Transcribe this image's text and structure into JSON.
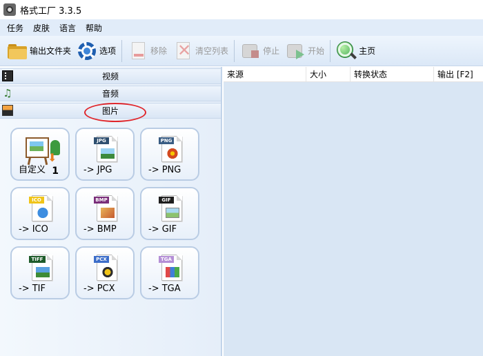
{
  "window": {
    "title": "格式工厂 3.3.5"
  },
  "menu": {
    "items": [
      "任务",
      "皮肤",
      "语言",
      "帮助"
    ]
  },
  "toolbar": {
    "output_folder": "输出文件夹",
    "options": "选项",
    "remove": "移除",
    "clear_list": "清空列表",
    "stop": "停止",
    "start": "开始",
    "home": "主页"
  },
  "categories": {
    "video": "视频",
    "audio": "音频",
    "image": "图片"
  },
  "image_tools": [
    {
      "label": "自定义",
      "badge": "1",
      "icon": "custom-icon"
    },
    {
      "label": "-> JPG",
      "tag": "JPG",
      "tag_color": "#2f4f6f",
      "icon": "jpg-file-icon"
    },
    {
      "label": "-> PNG",
      "tag": "PNG",
      "tag_color": "#3a5d83",
      "icon": "png-file-icon"
    },
    {
      "label": "-> ICO",
      "tag": "ICO",
      "tag_color": "#f0c419",
      "icon": "ico-file-icon"
    },
    {
      "label": "-> BMP",
      "tag": "BMP",
      "tag_color": "#7a2e7a",
      "icon": "bmp-file-icon"
    },
    {
      "label": "-> GIF",
      "tag": "GIF",
      "tag_color": "#1e1e1e",
      "icon": "gif-file-icon"
    },
    {
      "label": "-> TIF",
      "tag": "TIFF",
      "tag_color": "#1e5b2a",
      "icon": "tif-file-icon"
    },
    {
      "label": "-> PCX",
      "tag": "PCX",
      "tag_color": "#3d6ec9",
      "icon": "pcx-file-icon"
    },
    {
      "label": "-> TGA",
      "tag": "TGA",
      "tag_color": "#b48fd6",
      "icon": "tga-file-icon"
    }
  ],
  "task_table": {
    "columns": [
      "来源",
      "大小",
      "转换状态",
      "输出 [F2]"
    ]
  },
  "colors": {
    "highlight": "#e0262b",
    "panel_bg": "#d9e6f4"
  }
}
